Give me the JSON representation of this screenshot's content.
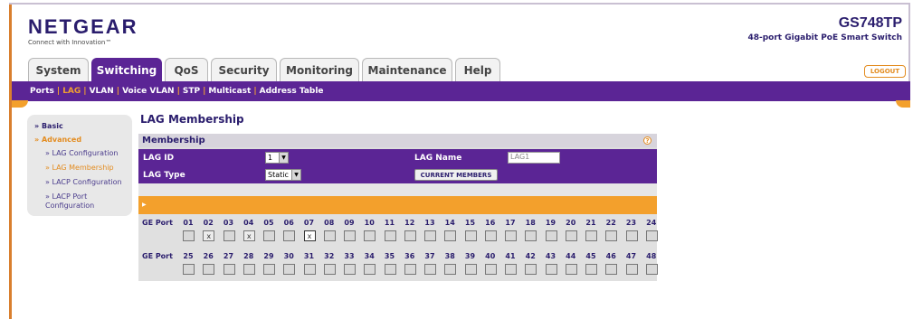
{
  "header": {
    "logo": "NETGEAR",
    "logo_sub": "Connect with Innovation™",
    "model": "GS748TP",
    "description": "48-port Gigabit PoE Smart Switch",
    "logout": "LOGOUT"
  },
  "tabs": [
    "System",
    "Switching",
    "QoS",
    "Security",
    "Monitoring",
    "Maintenance",
    "Help"
  ],
  "subnav": [
    "Ports",
    "LAG",
    "VLAN",
    "Voice VLAN",
    "STP",
    "Multicast",
    "Address Table"
  ],
  "sidebar": {
    "basic": "Basic",
    "advanced": "Advanced",
    "items": [
      "LAG Configuration",
      "LAG Membership",
      "LACP Configuration",
      "LACP Port Configuration"
    ]
  },
  "main": {
    "title": "LAG Membership",
    "panel_title": "Membership",
    "lag_id_label": "LAG ID",
    "lag_id_value": "1",
    "lag_name_label": "LAG Name",
    "lag_name_value": "LAG1",
    "lag_type_label": "LAG Type",
    "lag_type_value": "Static",
    "current_members_button": "CURRENT MEMBERS",
    "ge_port_label": "GE Port",
    "ports_row1": [
      "01",
      "02",
      "03",
      "04",
      "05",
      "06",
      "07",
      "08",
      "09",
      "10",
      "11",
      "12",
      "13",
      "14",
      "15",
      "16",
      "17",
      "18",
      "19",
      "20",
      "21",
      "22",
      "23",
      "24"
    ],
    "ports_row2": [
      "25",
      "26",
      "27",
      "28",
      "29",
      "30",
      "31",
      "32",
      "33",
      "34",
      "35",
      "36",
      "37",
      "38",
      "39",
      "40",
      "41",
      "42",
      "43",
      "44",
      "45",
      "46",
      "47",
      "48"
    ],
    "checked_ports": [
      "02",
      "04",
      "07"
    ]
  },
  "colors": {
    "purple": "#5b2595",
    "orange": "#f3a02c",
    "navy": "#2a1d6d"
  }
}
